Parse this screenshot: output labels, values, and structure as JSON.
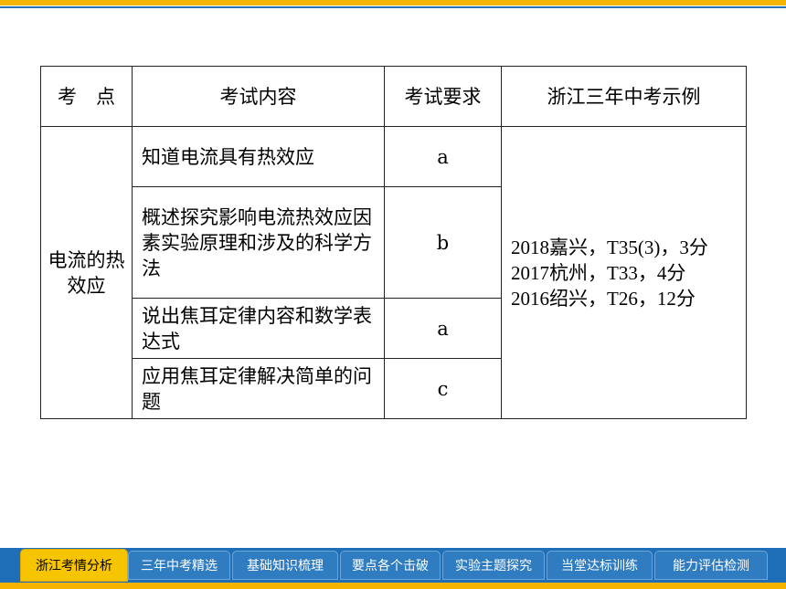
{
  "table": {
    "headers": [
      "考　点",
      "考试内容",
      "考试要求",
      "浙江三年中考示例"
    ],
    "topic": "电流的热效应",
    "rows": [
      {
        "content": "知道电流具有热效应",
        "requirement": "a"
      },
      {
        "content": "概述探究影响电流热效应因素实验原理和涉及的科学方法",
        "requirement": "b"
      },
      {
        "content": "说出焦耳定律内容和数学表达式",
        "requirement": "a"
      },
      {
        "content": "应用焦耳定律解决简单的问题",
        "requirement": "c"
      }
    ],
    "examples": [
      "2018嘉兴，T35(3)，3分",
      "2017杭州，T33，4分",
      "2016绍兴，T26，12分"
    ]
  },
  "nav": {
    "tabs": [
      "浙江考情分析",
      "三年中考精选",
      "基础知识梳理",
      "要点各个击破",
      "实验主题探究",
      "当堂达标训练",
      "能力评估检测"
    ],
    "active_index": 0
  },
  "colors": {
    "accent": "#f5b400",
    "nav_blue": "#1f6fb8"
  }
}
